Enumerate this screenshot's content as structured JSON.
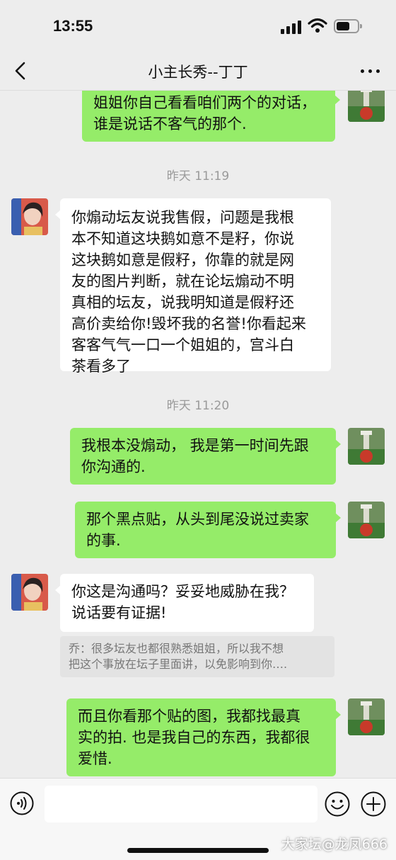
{
  "status_bar": {
    "time": "13:55"
  },
  "nav": {
    "title": "小主长秀--丁丁"
  },
  "messages": [
    {
      "from": "me",
      "lines": [
        "姐姐你自己看看咱们两个的对话，",
        "谁是说话不客气的那个."
      ]
    },
    {
      "timestamp": "昨天 11:19"
    },
    {
      "from": "other",
      "lines": [
        "你煽动坛友说我售假，问题是我根",
        "本不知道这块鹅如意不是籽，你说",
        "这块鹅如意是假籽，你靠的就是网",
        "友的图片判断，就在论坛煽动不明",
        "真相的坛友，说我明知道是假籽还",
        "高价卖给你!毁坏我的名誉!你看起来",
        "客客气气一口一个姐姐的，宫斗白",
        "茶看多了"
      ]
    },
    {
      "timestamp": "昨天 11:20"
    },
    {
      "from": "me",
      "lines": [
        "我根本没煽动， 我是第一时间先跟",
        "你沟通的."
      ]
    },
    {
      "from": "me",
      "lines": [
        "那个黑点贴，从头到尾没说过卖家",
        "的事."
      ]
    },
    {
      "from": "other",
      "lines": [
        "你这是沟通吗？妥妥地威胁在我？",
        "说话要有证据!"
      ]
    },
    {
      "quote": [
        "乔：很多坛友也都很熟悉姐姐，所以我不想",
        "把这个事放在坛子里面讲，以免影响到你…."
      ]
    },
    {
      "from": "me",
      "lines": [
        "而且你看那个贴的图，我都找最真",
        "实的拍. 也是我自己的东西，我都很",
        "爱惜."
      ]
    }
  ],
  "input_bar": {
    "placeholder": ""
  },
  "watermark": "大家坛@龙凤666"
}
